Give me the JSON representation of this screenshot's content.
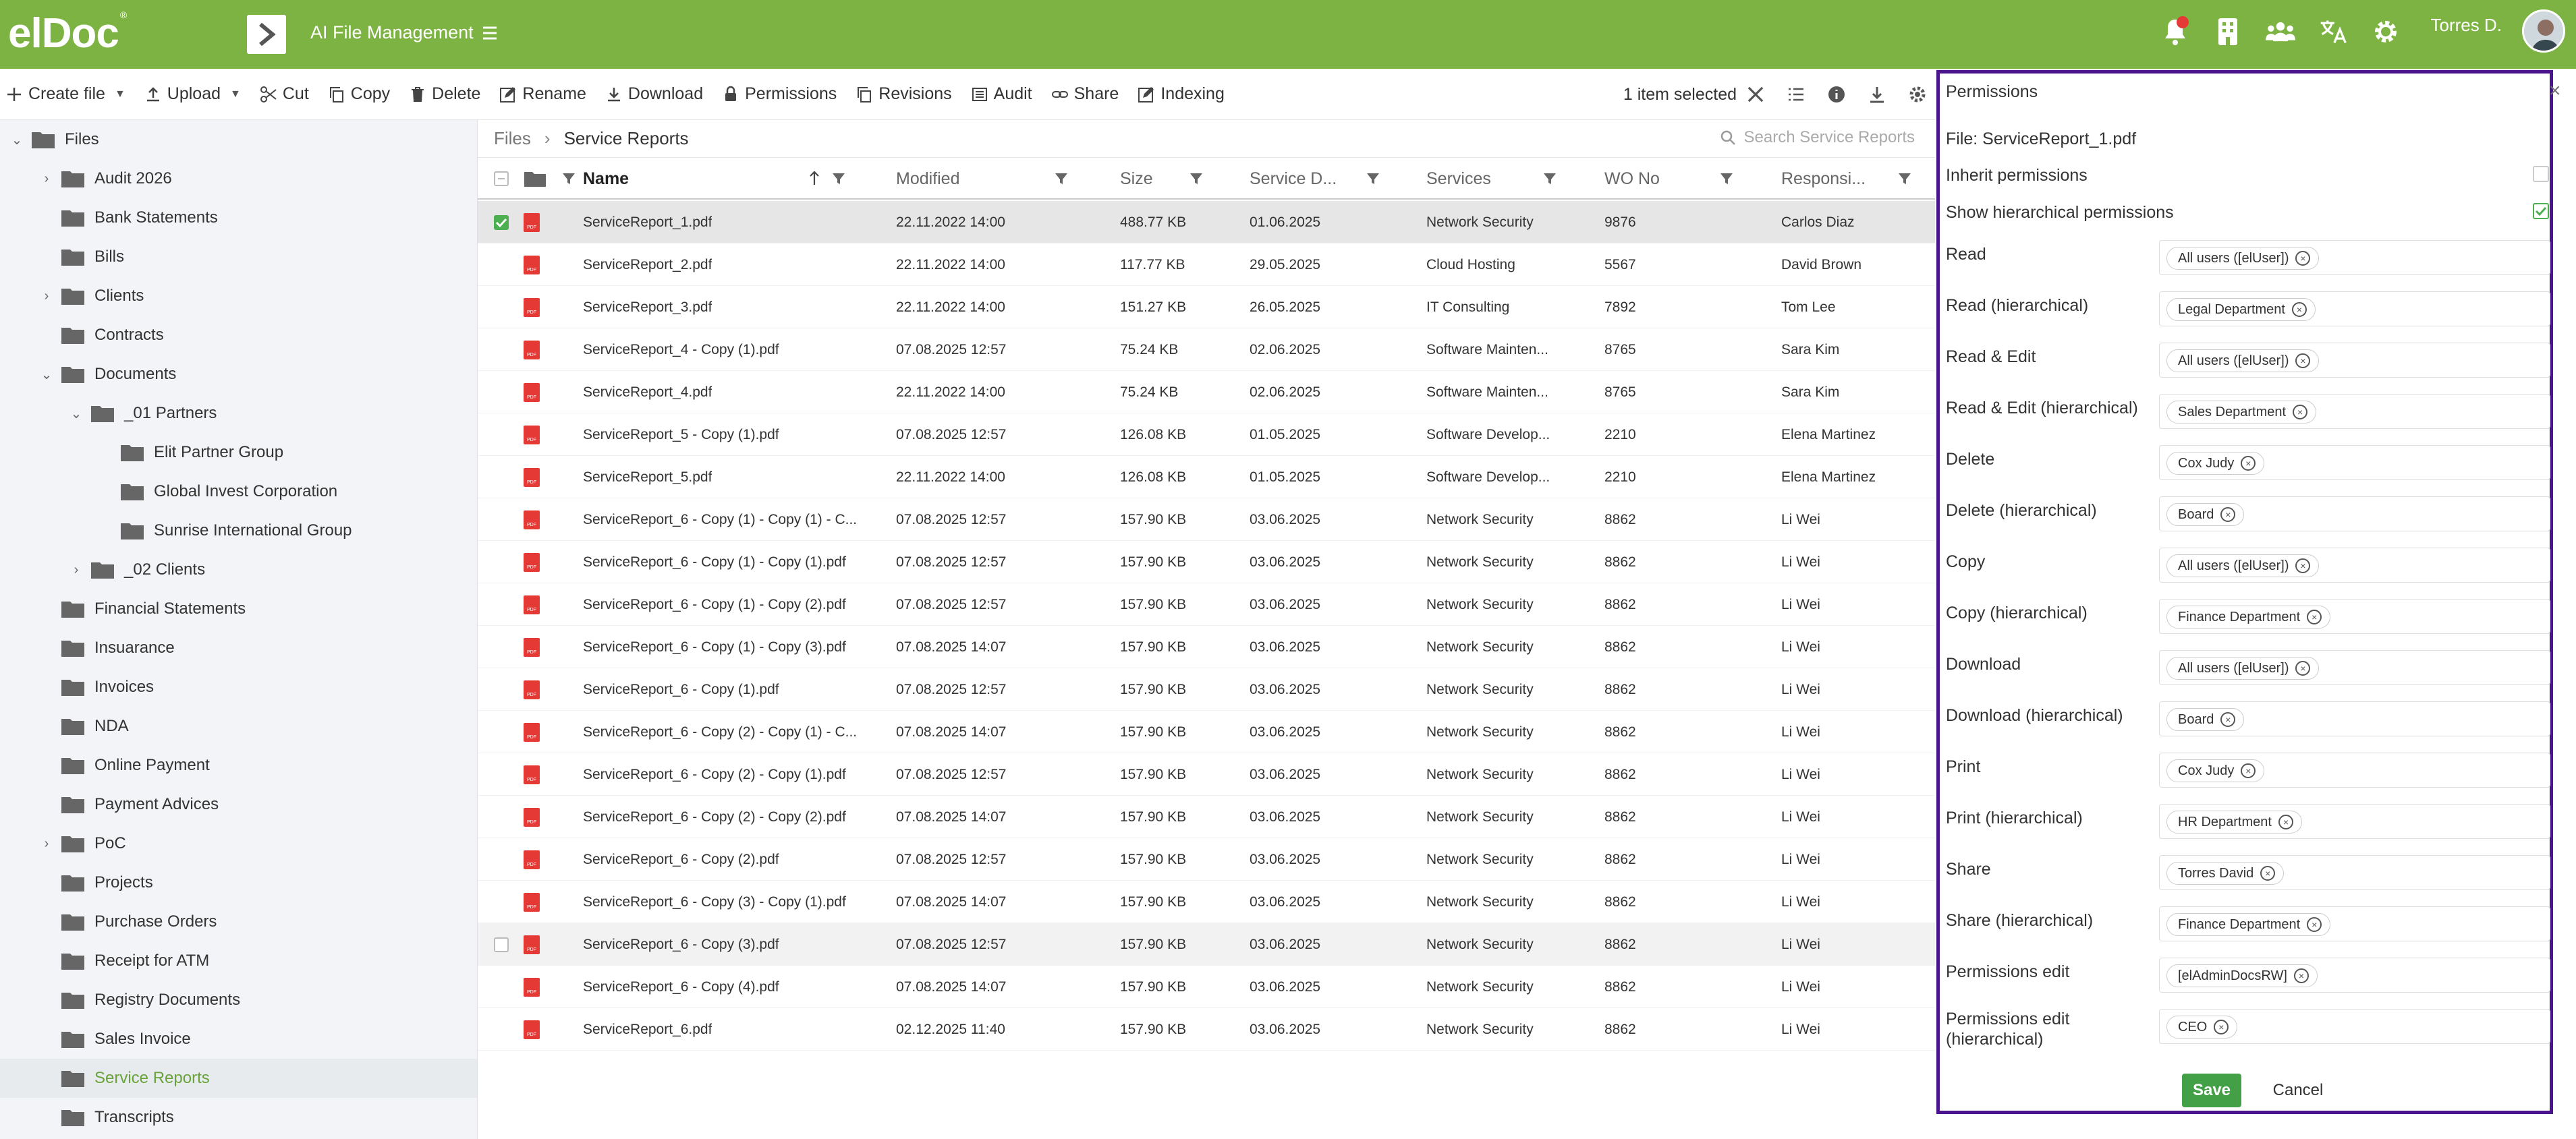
{
  "app": {
    "logo": "elDoc",
    "title": "AI File Management",
    "user": "Torres D.",
    "brand_color": "#7cb342",
    "accent_color": "#4a148c"
  },
  "header_icons": [
    "bell-icon",
    "building-icon",
    "users-icon",
    "translate-icon",
    "gear-icon"
  ],
  "toolbar": {
    "create": "Create file",
    "upload": "Upload",
    "cut": "Cut",
    "copy": "Copy",
    "delete": "Delete",
    "rename": "Rename",
    "download": "Download",
    "permissions": "Permissions",
    "revisions": "Revisions",
    "audit": "Audit",
    "share": "Share",
    "indexing": "Indexing",
    "selected": "1 item selected"
  },
  "tree": [
    {
      "label": "Files",
      "level": 0,
      "exp": "open"
    },
    {
      "label": "Audit 2026",
      "level": 1,
      "exp": "closed"
    },
    {
      "label": "Bank Statements",
      "level": 1,
      "exp": "none"
    },
    {
      "label": "Bills",
      "level": 1,
      "exp": "none"
    },
    {
      "label": "Clients",
      "level": 1,
      "exp": "closed"
    },
    {
      "label": "Contracts",
      "level": 1,
      "exp": "none"
    },
    {
      "label": "Documents",
      "level": 1,
      "exp": "open"
    },
    {
      "label": "_01 Partners",
      "level": 2,
      "exp": "open"
    },
    {
      "label": "Elit Partner Group",
      "level": 3,
      "exp": "none"
    },
    {
      "label": "Global Invest Corporation",
      "level": 3,
      "exp": "none"
    },
    {
      "label": "Sunrise International Group",
      "level": 3,
      "exp": "none"
    },
    {
      "label": "_02 Clients",
      "level": 2,
      "exp": "closed"
    },
    {
      "label": "Financial Statements",
      "level": 1,
      "exp": "none"
    },
    {
      "label": "Insuarance",
      "level": 1,
      "exp": "none"
    },
    {
      "label": "Invoices",
      "level": 1,
      "exp": "none"
    },
    {
      "label": "NDA",
      "level": 1,
      "exp": "none"
    },
    {
      "label": "Online Payment",
      "level": 1,
      "exp": "none"
    },
    {
      "label": "Payment Advices",
      "level": 1,
      "exp": "none"
    },
    {
      "label": "PoC",
      "level": 1,
      "exp": "closed"
    },
    {
      "label": "Projects",
      "level": 1,
      "exp": "none"
    },
    {
      "label": "Purchase Orders",
      "level": 1,
      "exp": "none"
    },
    {
      "label": "Receipt for ATM",
      "level": 1,
      "exp": "none"
    },
    {
      "label": "Registry Documents",
      "level": 1,
      "exp": "none"
    },
    {
      "label": "Sales Invoice",
      "level": 1,
      "exp": "none"
    },
    {
      "label": "Service Reports",
      "level": 1,
      "exp": "none",
      "selected": true
    },
    {
      "label": "Transcripts",
      "level": 1,
      "exp": "none"
    }
  ],
  "breadcrumb": {
    "root": "Files",
    "current": "Service Reports",
    "search_placeholder": "Search Service Reports"
  },
  "columns": [
    "Name",
    "Modified",
    "Size",
    "Service D...",
    "Services",
    "WO No",
    "Responsi..."
  ],
  "rows": [
    {
      "name": "ServiceReport_1.pdf",
      "modified": "22.11.2022 14:00",
      "size": "488.77 KB",
      "service_date": "01.06.2025",
      "services": "Network Security",
      "wo": "9876",
      "resp": "Carlos Diaz",
      "state": "selected"
    },
    {
      "name": "ServiceReport_2.pdf",
      "modified": "22.11.2022 14:00",
      "size": "117.77 KB",
      "service_date": "29.05.2025",
      "services": "Cloud Hosting",
      "wo": "5567",
      "resp": "David Brown"
    },
    {
      "name": "ServiceReport_3.pdf",
      "modified": "22.11.2022 14:00",
      "size": "151.27 KB",
      "service_date": "26.05.2025",
      "services": "IT Consulting",
      "wo": "7892",
      "resp": "Tom Lee"
    },
    {
      "name": "ServiceReport_4 - Copy (1).pdf",
      "modified": "07.08.2025 12:57",
      "size": "75.24 KB",
      "service_date": "02.06.2025",
      "services": "Software Mainten...",
      "wo": "8765",
      "resp": "Sara Kim"
    },
    {
      "name": "ServiceReport_4.pdf",
      "modified": "22.11.2022 14:00",
      "size": "75.24 KB",
      "service_date": "02.06.2025",
      "services": "Software Mainten...",
      "wo": "8765",
      "resp": "Sara Kim"
    },
    {
      "name": "ServiceReport_5 - Copy (1).pdf",
      "modified": "07.08.2025 12:57",
      "size": "126.08 KB",
      "service_date": "01.05.2025",
      "services": "Software Develop...",
      "wo": "2210",
      "resp": "Elena Martinez"
    },
    {
      "name": "ServiceReport_5.pdf",
      "modified": "22.11.2022 14:00",
      "size": "126.08 KB",
      "service_date": "01.05.2025",
      "services": "Software Develop...",
      "wo": "2210",
      "resp": "Elena Martinez"
    },
    {
      "name": "ServiceReport_6 - Copy (1) - Copy (1) - C...",
      "modified": "07.08.2025 12:57",
      "size": "157.90 KB",
      "service_date": "03.06.2025",
      "services": "Network Security",
      "wo": "8862",
      "resp": "Li Wei"
    },
    {
      "name": "ServiceReport_6 - Copy (1) - Copy (1).pdf",
      "modified": "07.08.2025 12:57",
      "size": "157.90 KB",
      "service_date": "03.06.2025",
      "services": "Network Security",
      "wo": "8862",
      "resp": "Li Wei"
    },
    {
      "name": "ServiceReport_6 - Copy (1) - Copy (2).pdf",
      "modified": "07.08.2025 12:57",
      "size": "157.90 KB",
      "service_date": "03.06.2025",
      "services": "Network Security",
      "wo": "8862",
      "resp": "Li Wei"
    },
    {
      "name": "ServiceReport_6 - Copy (1) - Copy (3).pdf",
      "modified": "07.08.2025 14:07",
      "size": "157.90 KB",
      "service_date": "03.06.2025",
      "services": "Network Security",
      "wo": "8862",
      "resp": "Li Wei"
    },
    {
      "name": "ServiceReport_6 - Copy (1).pdf",
      "modified": "07.08.2025 12:57",
      "size": "157.90 KB",
      "service_date": "03.06.2025",
      "services": "Network Security",
      "wo": "8862",
      "resp": "Li Wei"
    },
    {
      "name": "ServiceReport_6 - Copy (2) - Copy (1) - C...",
      "modified": "07.08.2025 14:07",
      "size": "157.90 KB",
      "service_date": "03.06.2025",
      "services": "Network Security",
      "wo": "8862",
      "resp": "Li Wei"
    },
    {
      "name": "ServiceReport_6 - Copy (2) - Copy (1).pdf",
      "modified": "07.08.2025 12:57",
      "size": "157.90 KB",
      "service_date": "03.06.2025",
      "services": "Network Security",
      "wo": "8862",
      "resp": "Li Wei"
    },
    {
      "name": "ServiceReport_6 - Copy (2) - Copy (2).pdf",
      "modified": "07.08.2025 14:07",
      "size": "157.90 KB",
      "service_date": "03.06.2025",
      "services": "Network Security",
      "wo": "8862",
      "resp": "Li Wei"
    },
    {
      "name": "ServiceReport_6 - Copy (2).pdf",
      "modified": "07.08.2025 12:57",
      "size": "157.90 KB",
      "service_date": "03.06.2025",
      "services": "Network Security",
      "wo": "8862",
      "resp": "Li Wei"
    },
    {
      "name": "ServiceReport_6 - Copy (3) - Copy (1).pdf",
      "modified": "07.08.2025 14:07",
      "size": "157.90 KB",
      "service_date": "03.06.2025",
      "services": "Network Security",
      "wo": "8862",
      "resp": "Li Wei"
    },
    {
      "name": "ServiceReport_6 - Copy (3).pdf",
      "modified": "07.08.2025 12:57",
      "size": "157.90 KB",
      "service_date": "03.06.2025",
      "services": "Network Security",
      "wo": "8862",
      "resp": "Li Wei",
      "state": "hover"
    },
    {
      "name": "ServiceReport_6 - Copy (4).pdf",
      "modified": "07.08.2025 14:07",
      "size": "157.90 KB",
      "service_date": "03.06.2025",
      "services": "Network Security",
      "wo": "8862",
      "resp": "Li Wei"
    },
    {
      "name": "ServiceReport_6.pdf",
      "modified": "02.12.2025 11:40",
      "size": "157.90 KB",
      "service_date": "03.06.2025",
      "services": "Network Security",
      "wo": "8862",
      "resp": "Li Wei"
    }
  ],
  "permissions": {
    "title": "Permissions",
    "file": "File: ServiceReport_1.pdf",
    "inherit": "Inherit permissions",
    "inherit_checked": false,
    "show_hier": "Show hierarchical permissions",
    "show_hier_checked": true,
    "fields": [
      {
        "label": "Read",
        "value": "All users ([elUser])"
      },
      {
        "label": "Read (hierarchical)",
        "value": "Legal Department"
      },
      {
        "label": "Read & Edit",
        "value": "All users ([elUser])"
      },
      {
        "label": "Read & Edit (hierarchical)",
        "value": "Sales Department"
      },
      {
        "label": "Delete",
        "value": "Cox Judy"
      },
      {
        "label": "Delete (hierarchical)",
        "value": "Board"
      },
      {
        "label": "Copy",
        "value": "All users ([elUser])"
      },
      {
        "label": "Copy (hierarchical)",
        "value": "Finance Department"
      },
      {
        "label": "Download",
        "value": "All users ([elUser])"
      },
      {
        "label": "Download (hierarchical)",
        "value": "Board"
      },
      {
        "label": "Print",
        "value": "Cox Judy"
      },
      {
        "label": "Print (hierarchical)",
        "value": "HR Department"
      },
      {
        "label": "Share",
        "value": "Torres David"
      },
      {
        "label": "Share (hierarchical)",
        "value": "Finance Department"
      },
      {
        "label": "Permissions edit",
        "value": "[elAdminDocsRW]"
      },
      {
        "label": "Permissions edit (hierarchical)",
        "value": "CEO"
      }
    ],
    "save": "Save",
    "cancel": "Cancel"
  }
}
